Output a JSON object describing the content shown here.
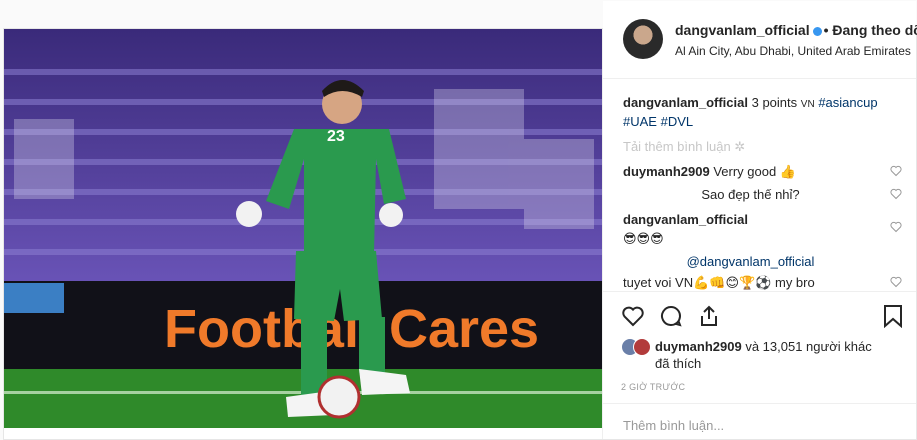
{
  "header": {
    "username": "dangvanlam_official",
    "follow_status": "• Đang theo dõ",
    "location": "Al Ain City, Abu Dhabi, United Arab Emirates"
  },
  "photo": {
    "banner_text": "Football Cares",
    "jersey_number": "23"
  },
  "caption": {
    "username": "dangvanlam_official",
    "text": "3 points",
    "flag": "VN",
    "hashtags": [
      "#asiancup",
      "#UAE",
      "#DVL"
    ]
  },
  "load_more": "Tải thêm bình luận",
  "comments": [
    {
      "username": "duymanh2909",
      "text": "Verry good 👍"
    },
    {
      "username": "",
      "text": "Sao đẹp thế nhỉ?"
    },
    {
      "username": "dangvanlam_official",
      "text": "😎😎😎"
    },
    {
      "username": "",
      "text": "@dangvanlam_official"
    },
    {
      "username": "",
      "text": "tuyet voi VN💪👊😊🏆⚽ my bro"
    }
  ],
  "likes": {
    "liker": "duymanh2909",
    "rest": "và 13,051 người khác",
    "suffix": "đã thích"
  },
  "timestamp": "2 GIỜ TRƯỚC",
  "add_comment_placeholder": "Thêm bình luận..."
}
